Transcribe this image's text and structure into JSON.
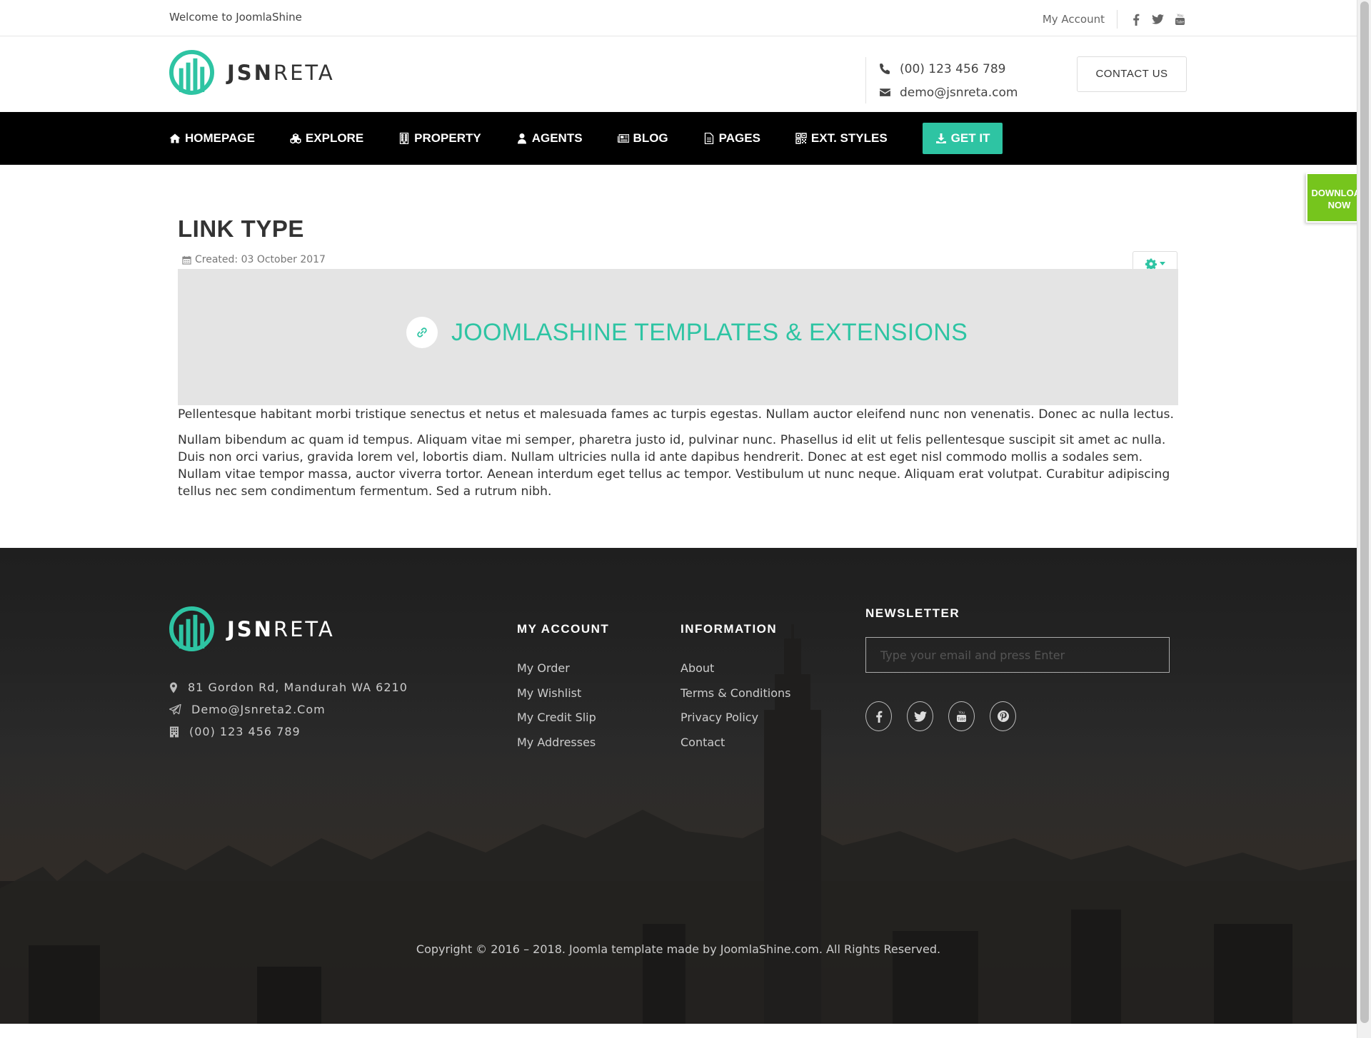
{
  "topbar": {
    "welcome": "Welcome to JoomlaShine",
    "account": "My Account",
    "social_icons": [
      "facebook-icon",
      "twitter-icon",
      "youtube-icon"
    ]
  },
  "header": {
    "logo_bold": "JSN",
    "logo_light": "RETA",
    "phone": "(00) 123 456 789",
    "email": "demo@jsnreta.com",
    "contact_button": "CONTACT US"
  },
  "nav": {
    "items": [
      {
        "label": "HOMEPAGE",
        "icon": "home-icon"
      },
      {
        "label": "EXPLORE",
        "icon": "cubes-icon"
      },
      {
        "label": "PROPERTY",
        "icon": "building-icon"
      },
      {
        "label": "AGENTS",
        "icon": "user-icon"
      },
      {
        "label": "BLOG",
        "icon": "newspaper-icon"
      },
      {
        "label": "PAGES",
        "icon": "file-icon"
      },
      {
        "label": "EXT. STYLES",
        "icon": "qrcode-icon"
      }
    ],
    "cta": "GET IT",
    "cta_color": "#2ec4a3"
  },
  "download_tab": {
    "line1": "DOWNLOAD",
    "line2": "NOW",
    "color": "#76c51d"
  },
  "article": {
    "title": "LINK TYPE",
    "created": "Created: 03 October 2017",
    "link_text": "JOOMLASHINE TEMPLATES & EXTENSIONS",
    "paragraphs": [
      "Pellentesque habitant morbi tristique senectus et netus et malesuada fames ac turpis egestas. Nullam auctor eleifend nunc non venenatis. Donec ac nulla lectus.",
      "Nullam bibendum ac quam id tempus. Aliquam vitae mi semper, pharetra justo id, pulvinar nunc. Phasellus id elit ut felis pellentesque suscipit sit amet ac nulla. Duis non orci varius, gravida lorem vel, lobortis diam. Nullam ultricies nulla id ante dapibus hendrerit. Donec at est eget nisl commodo mollis a sodales sem. Nullam vitae tempor massa, auctor viverra tortor. Aenean interdum eget tellus ac tempor. Vestibulum ut nunc neque. Aliquam erat volutpat. Curabitur adipiscing tellus nec sem condimentum fermentum. Sed a rutrum nibh."
    ]
  },
  "footer": {
    "address": "81 Gordon Rd, Mandurah WA 6210",
    "email": "Demo@Jsnreta2.Com",
    "phone": "(00) 123 456 789",
    "my_account": {
      "heading": "MY ACCOUNT",
      "links": [
        "My Order",
        "My Wishlist",
        "My Credit Slip",
        "My Addresses"
      ]
    },
    "information": {
      "heading": "INFORMATION",
      "links": [
        "About",
        "Terms & Conditions",
        "Privacy Policy",
        "Contact"
      ]
    },
    "newsletter": {
      "heading": "NEWSLETTER",
      "placeholder": "Type your email and press Enter",
      "social_icons": [
        "facebook-icon",
        "twitter-icon",
        "youtube-icon",
        "pinterest-icon"
      ]
    },
    "copyright": "Copyright © 2016 – 2018. Joomla template made by JoomlaShine.com. All Rights Reserved."
  },
  "colors": {
    "accent": "#2ec4a3",
    "nav_bg": "#000000",
    "download": "#76c51d"
  }
}
